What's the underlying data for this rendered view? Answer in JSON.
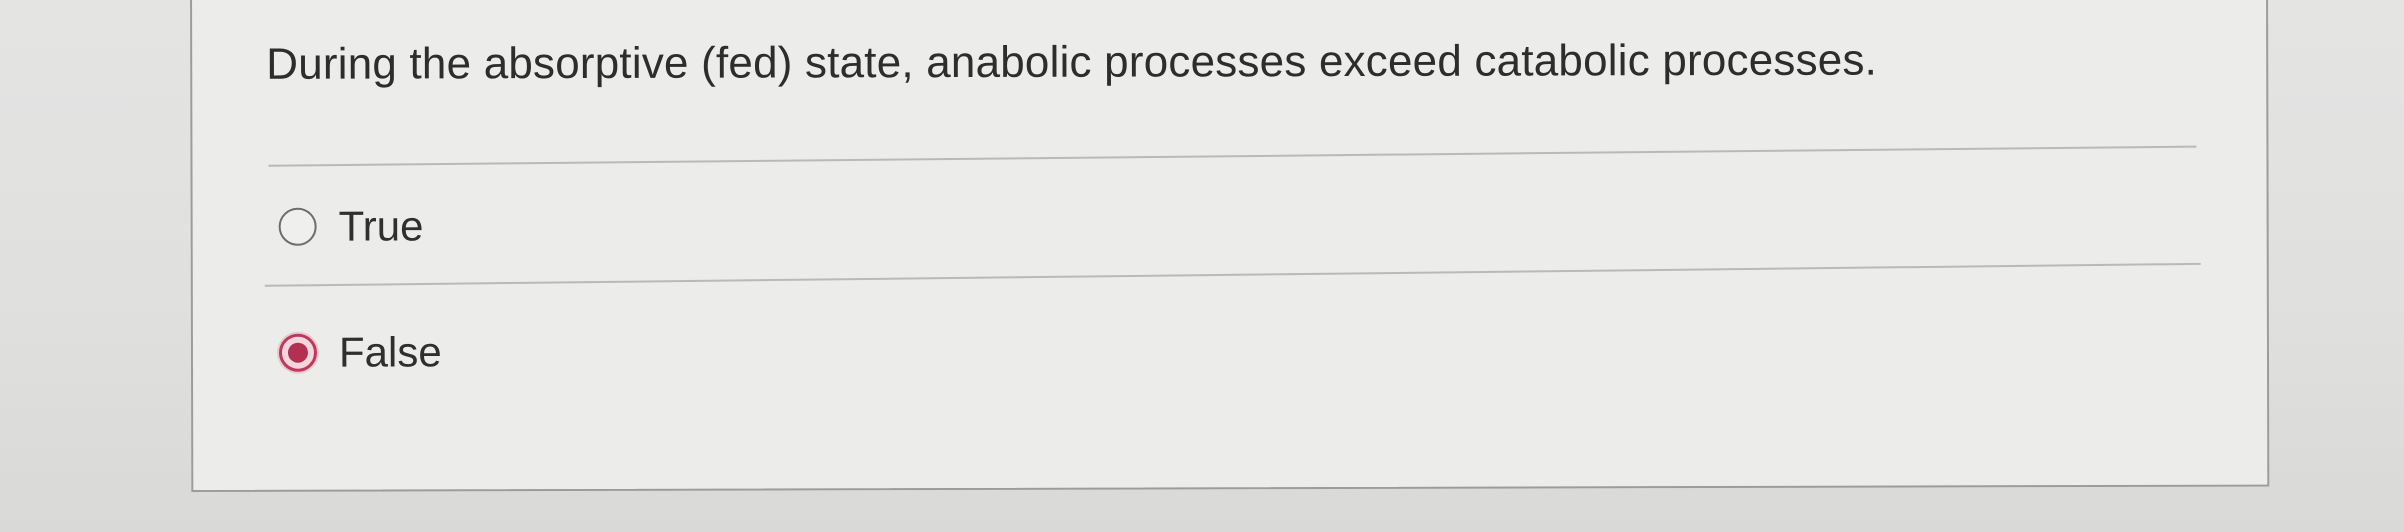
{
  "question": {
    "text": "During the absorptive (fed) state, anabolic processes exceed catabolic processes.",
    "selected": "False"
  },
  "options": [
    {
      "label": "True",
      "selected": false
    },
    {
      "label": "False",
      "selected": true
    }
  ],
  "colors": {
    "selected_radio": "#b23050",
    "background": "#e2e2e1",
    "card": "#ececeb",
    "text": "#2d2d2d"
  },
  "icons": {
    "unselected": "radio-unselected-icon",
    "selected": "radio-selected-icon"
  }
}
